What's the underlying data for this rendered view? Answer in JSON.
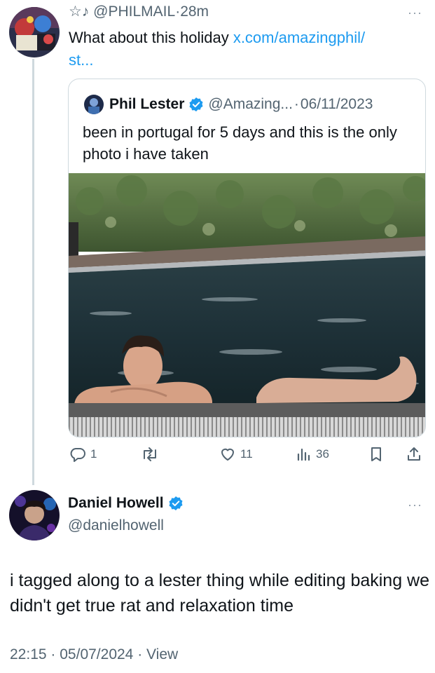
{
  "reply": {
    "star": "☆",
    "note": "♪",
    "handle": "@PHILMAIL",
    "dot": "·",
    "time": "28m",
    "text_prefix": "What about this holiday ",
    "link": "x.com/amazingphil/",
    "link_cont": "st...",
    "more": "···"
  },
  "quote": {
    "name": "Phil Lester",
    "handle": "@Amazing...",
    "dot": "·",
    "date": "06/11/2023",
    "text": "been in portugal for 5 days and this is the only photo i have taken"
  },
  "actions": {
    "replies": "1",
    "likes": "11",
    "views": "36"
  },
  "main": {
    "name": "Daniel Howell",
    "handle": "@danielhowell",
    "more": "···",
    "text": "i tagged along to a lester thing while editing baking we didn't get true rat and relaxation time",
    "time": "22:15",
    "dot1": "·",
    "date": "05/07/2024",
    "dot2": "·",
    "view": "View"
  },
  "colors": {
    "link": "#1d9bf0",
    "verified": "#1d9bf0",
    "secondary": "#536471"
  }
}
